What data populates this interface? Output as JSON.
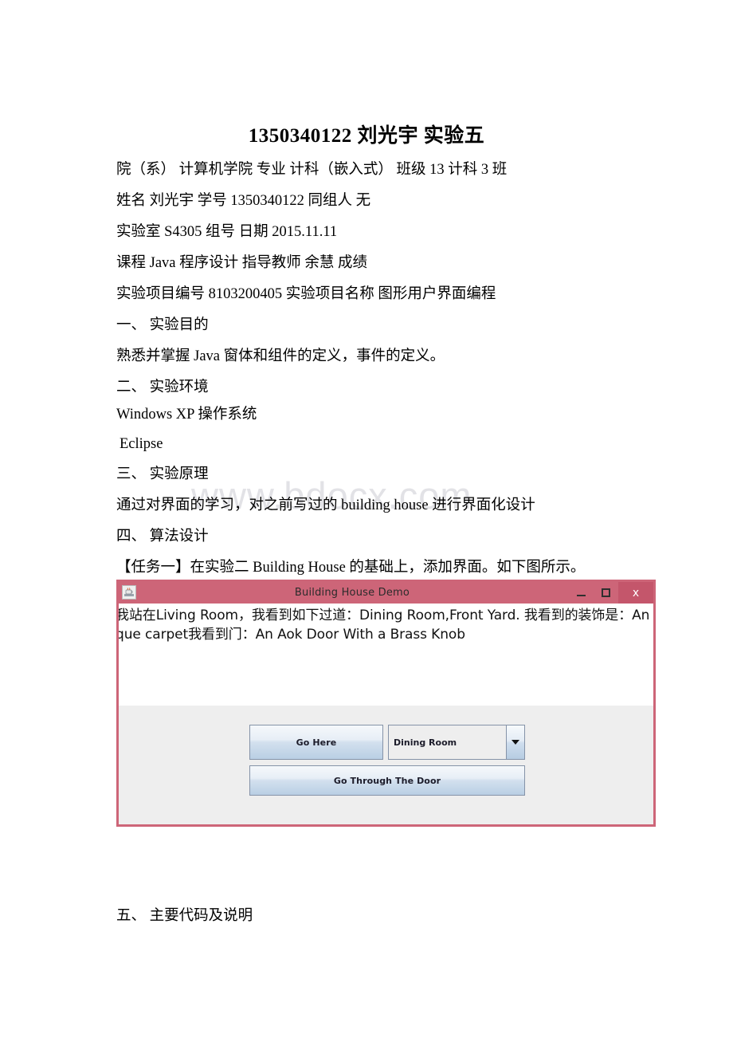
{
  "document": {
    "title": "1350340122 刘光宇 实验五",
    "watermark": "www.bdocx.com",
    "lines": [
      "院（系） 计算机学院  专业  计科（嵌入式）  班级  13 计科 3 班",
      "姓名  刘光宇  学号  1350340122  同组人  无",
      "实验室  S4305 组号   日期  2015.11.11",
      "课程 Java 程序设计  指导教师  余慧  成绩",
      "实验项目编号 8103200405 实验项目名称 图形用户界面编程",
      "一、 实验目的",
      "熟悉并掌握 Java 窗体和组件的定义，事件的定义。",
      "二、 实验环境",
      "Windows XP 操作系统",
      " Eclipse",
      "三、 实验原理",
      " 通过对界面的学习，对之前写过的 building house 进行界面化设计",
      "四、 算法设计",
      "【任务一】在实验二 Building House 的基础上，添加界面。如下图所示。",
      "五、 主要代码及说明"
    ]
  },
  "java_window": {
    "title": "Building House Demo",
    "app_icon": "java-coffee-cup-icon",
    "window_buttons": {
      "minimize": "–",
      "maximize": "❐",
      "close": "x"
    },
    "textarea": {
      "line1": "我站在Living Room，我看到如下过道：Dining Room,Front Yard. 我看到的装饰是：An anti",
      "line2": "que carpet我看到门：An Aok Door With a Brass Knob"
    },
    "controls": {
      "go_here_label": "Go Here",
      "combo_value": "Dining Room",
      "go_through_door_label": "Go Through The Door"
    },
    "colors": {
      "title_bar": "#cd6578",
      "close_button": "#c4566b",
      "panel": "#eeeeee",
      "border": "#cd6578"
    }
  }
}
